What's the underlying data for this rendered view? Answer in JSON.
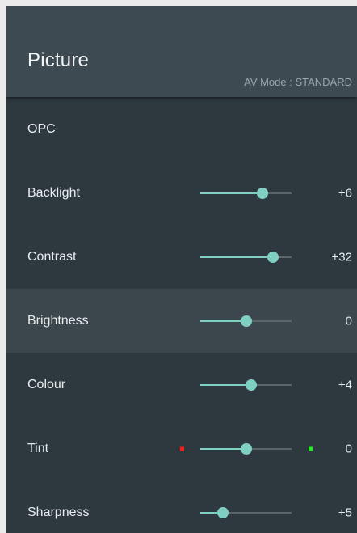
{
  "header": {
    "title": "Picture",
    "av_mode": "AV Mode : STANDARD"
  },
  "colors": {
    "panel_bg": "#2d383f",
    "header_bg": "#3d4a52",
    "selected_row_bg": "#3c474d",
    "slider_accent": "#7fcfc3",
    "slider_track": "#5a666c",
    "tint_red": "#ff1a1a",
    "tint_green": "#22ee22"
  },
  "settings": [
    {
      "label": "OPC",
      "value": ""
    },
    {
      "label": "Backlight",
      "value": "+6",
      "level": 0.68
    },
    {
      "label": "Contrast",
      "value": "+32",
      "level": 0.8
    },
    {
      "label": "Brightness",
      "value": "0",
      "level": 0.5,
      "selected": true
    },
    {
      "label": "Colour",
      "value": "+4",
      "level": 0.56
    },
    {
      "label": "Tint",
      "value": "0",
      "level": 0.5,
      "tint_markers": [
        "red-marker",
        "green-marker"
      ]
    },
    {
      "label": "Sharpness",
      "value": "+5",
      "level": 0.25
    }
  ]
}
